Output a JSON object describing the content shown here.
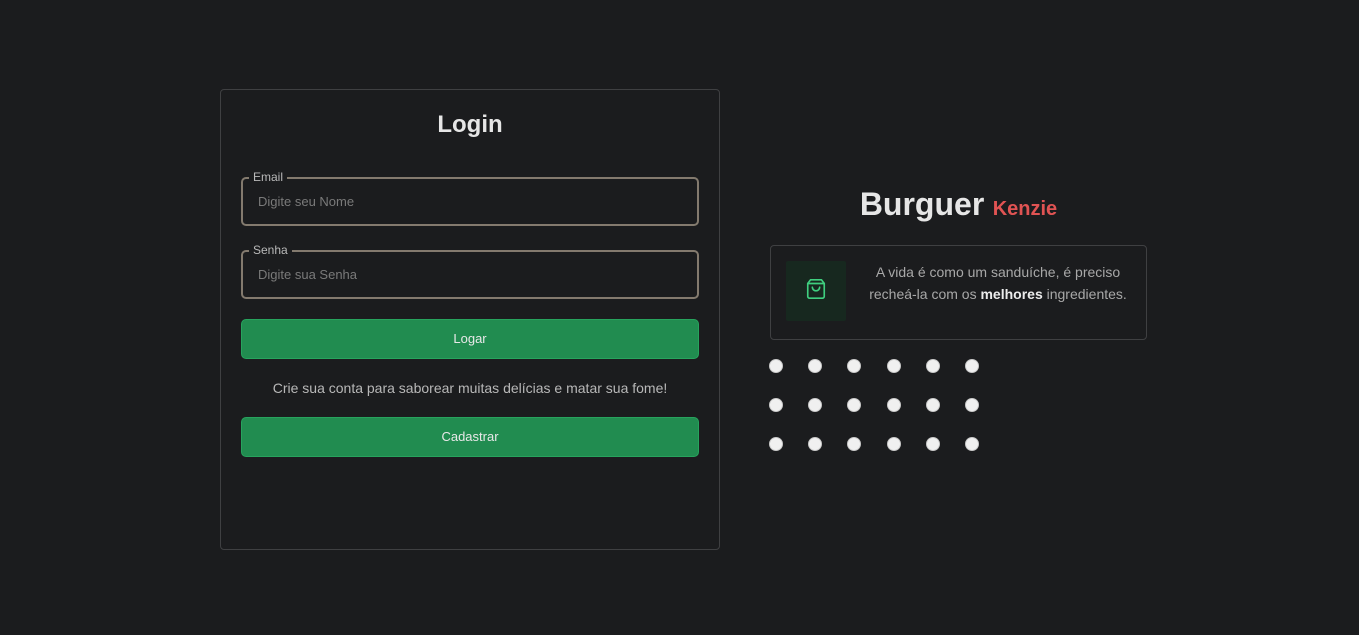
{
  "login": {
    "title": "Login",
    "email": {
      "label": "Email",
      "placeholder": "Digite seu Nome",
      "value": ""
    },
    "password": {
      "label": "Senha",
      "placeholder": "Digite sua Senha",
      "value": ""
    },
    "login_button": "Logar",
    "signup_text": "Crie sua conta para saborear muitas delícias e matar sua fome!",
    "signup_button": "Cadastrar"
  },
  "brand": {
    "name": "Burguer",
    "suffix": "Kenzie"
  },
  "info": {
    "icon": "shopping-bag-icon",
    "text_before": "A vida é como um sanduíche, é preciso recheá-la com os ",
    "text_bold": "melhores",
    "text_after": " ingredientes."
  },
  "decoration": {
    "dot_rows": 3,
    "dot_cols": 6
  },
  "colors": {
    "background": "#1b1c1e",
    "primary_green": "#218c50",
    "brand_red": "#e05353",
    "border": "#3f4042",
    "input_border": "#837a6e"
  }
}
